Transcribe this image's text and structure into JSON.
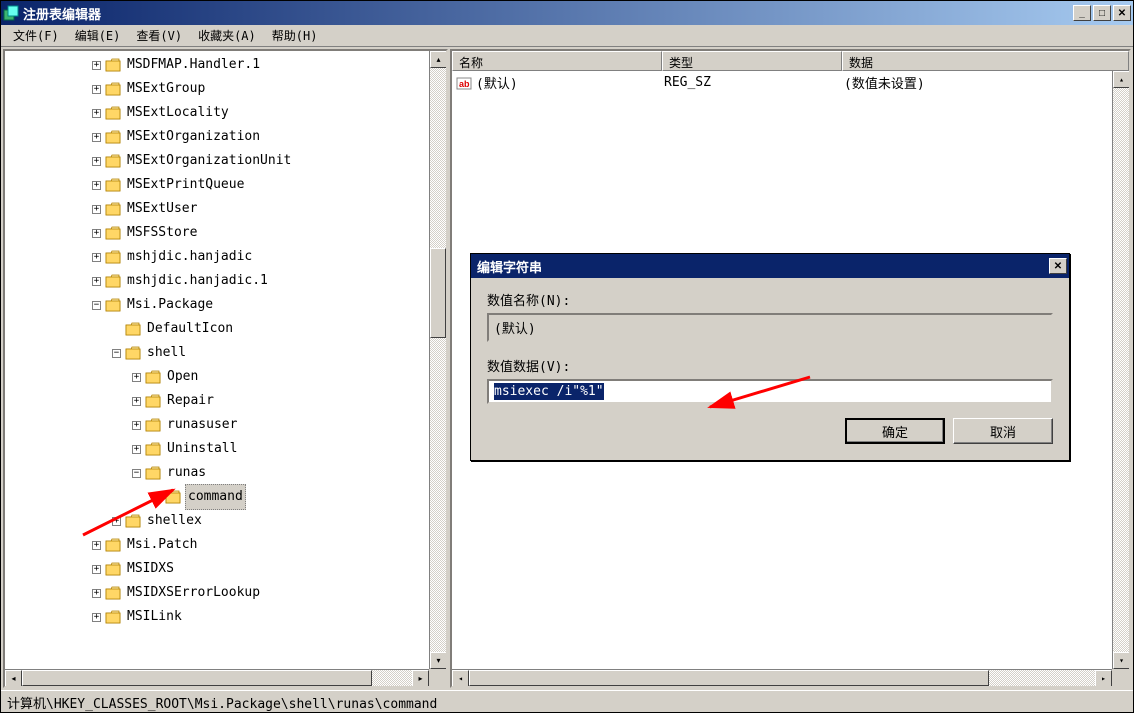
{
  "window": {
    "title": "注册表编辑器"
  },
  "menu": {
    "file": "文件(F)",
    "edit": "编辑(E)",
    "view": "查看(V)",
    "favorites": "收藏夹(A)",
    "help": "帮助(H)"
  },
  "tree": {
    "items": [
      {
        "indent": 3,
        "exp": "+",
        "label": "MSDFMAP.Handler.1"
      },
      {
        "indent": 3,
        "exp": "+",
        "label": "MSExtGroup"
      },
      {
        "indent": 3,
        "exp": "+",
        "label": "MSExtLocality"
      },
      {
        "indent": 3,
        "exp": "+",
        "label": "MSExtOrganization"
      },
      {
        "indent": 3,
        "exp": "+",
        "label": "MSExtOrganizationUnit"
      },
      {
        "indent": 3,
        "exp": "+",
        "label": "MSExtPrintQueue"
      },
      {
        "indent": 3,
        "exp": "+",
        "label": "MSExtUser"
      },
      {
        "indent": 3,
        "exp": "+",
        "label": "MSFSStore"
      },
      {
        "indent": 3,
        "exp": "+",
        "label": "mshjdic.hanjadic"
      },
      {
        "indent": 3,
        "exp": "+",
        "label": "mshjdic.hanjadic.1"
      },
      {
        "indent": 3,
        "exp": "-",
        "label": "Msi.Package"
      },
      {
        "indent": 4,
        "exp": "",
        "label": "DefaultIcon"
      },
      {
        "indent": 4,
        "exp": "-",
        "label": "shell"
      },
      {
        "indent": 5,
        "exp": "+",
        "label": "Open"
      },
      {
        "indent": 5,
        "exp": "+",
        "label": "Repair"
      },
      {
        "indent": 5,
        "exp": "+",
        "label": "runasuser"
      },
      {
        "indent": 5,
        "exp": "+",
        "label": "Uninstall"
      },
      {
        "indent": 5,
        "exp": "-",
        "label": "runas"
      },
      {
        "indent": 6,
        "exp": "",
        "label": "command",
        "selected": true
      },
      {
        "indent": 4,
        "exp": "+",
        "label": "shellex"
      },
      {
        "indent": 3,
        "exp": "+",
        "label": "Msi.Patch"
      },
      {
        "indent": 3,
        "exp": "+",
        "label": "MSIDXS"
      },
      {
        "indent": 3,
        "exp": "+",
        "label": "MSIDXSErrorLookup"
      },
      {
        "indent": 3,
        "exp": "+",
        "label": "MSILink"
      }
    ]
  },
  "list": {
    "columns": {
      "name": "名称",
      "type": "类型",
      "data": "数据"
    },
    "rows": [
      {
        "name": "(默认)",
        "type": "REG_SZ",
        "data": "(数值未设置)"
      }
    ]
  },
  "dialog": {
    "title": "编辑字符串",
    "name_label": "数值名称(N):",
    "name_value": "(默认)",
    "data_label": "数值数据(V):",
    "data_value": "msiexec /i\"%1\"",
    "ok": "确定",
    "cancel": "取消"
  },
  "statusbar": "计算机\\HKEY_CLASSES_ROOT\\Msi.Package\\shell\\runas\\command"
}
